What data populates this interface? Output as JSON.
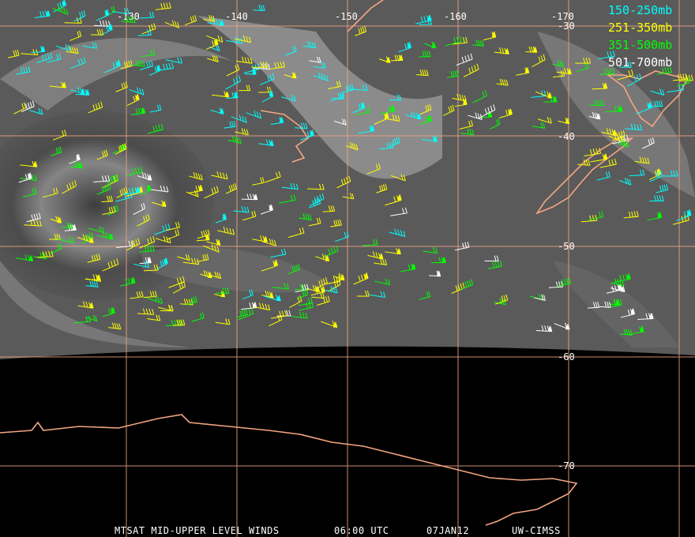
{
  "map": {
    "longitude_labels": [
      "-130",
      "-140",
      "-150",
      "-160",
      "-170"
    ],
    "latitude_labels": [
      "-30",
      "-40",
      "-50",
      "-60",
      "-70"
    ],
    "colors": {
      "grid": "#f4a582",
      "coast": "#f4a582",
      "background_space": "#000000",
      "satellite_gray": "#5a5a5a"
    }
  },
  "legend": {
    "items": [
      {
        "label": "150-250mb",
        "color": "#00ffff"
      },
      {
        "label": "251-350mb",
        "color": "#ffff00"
      },
      {
        "label": "351-500mb",
        "color": "#00ff00"
      },
      {
        "label": "501-700mb",
        "color": "#ffffff"
      }
    ]
  },
  "footer": {
    "product": "MTSAT MID-UPPER LEVEL WINDS",
    "time": "06:00 UTC",
    "date": "07JAN12",
    "source": "UW-CIMSS"
  }
}
